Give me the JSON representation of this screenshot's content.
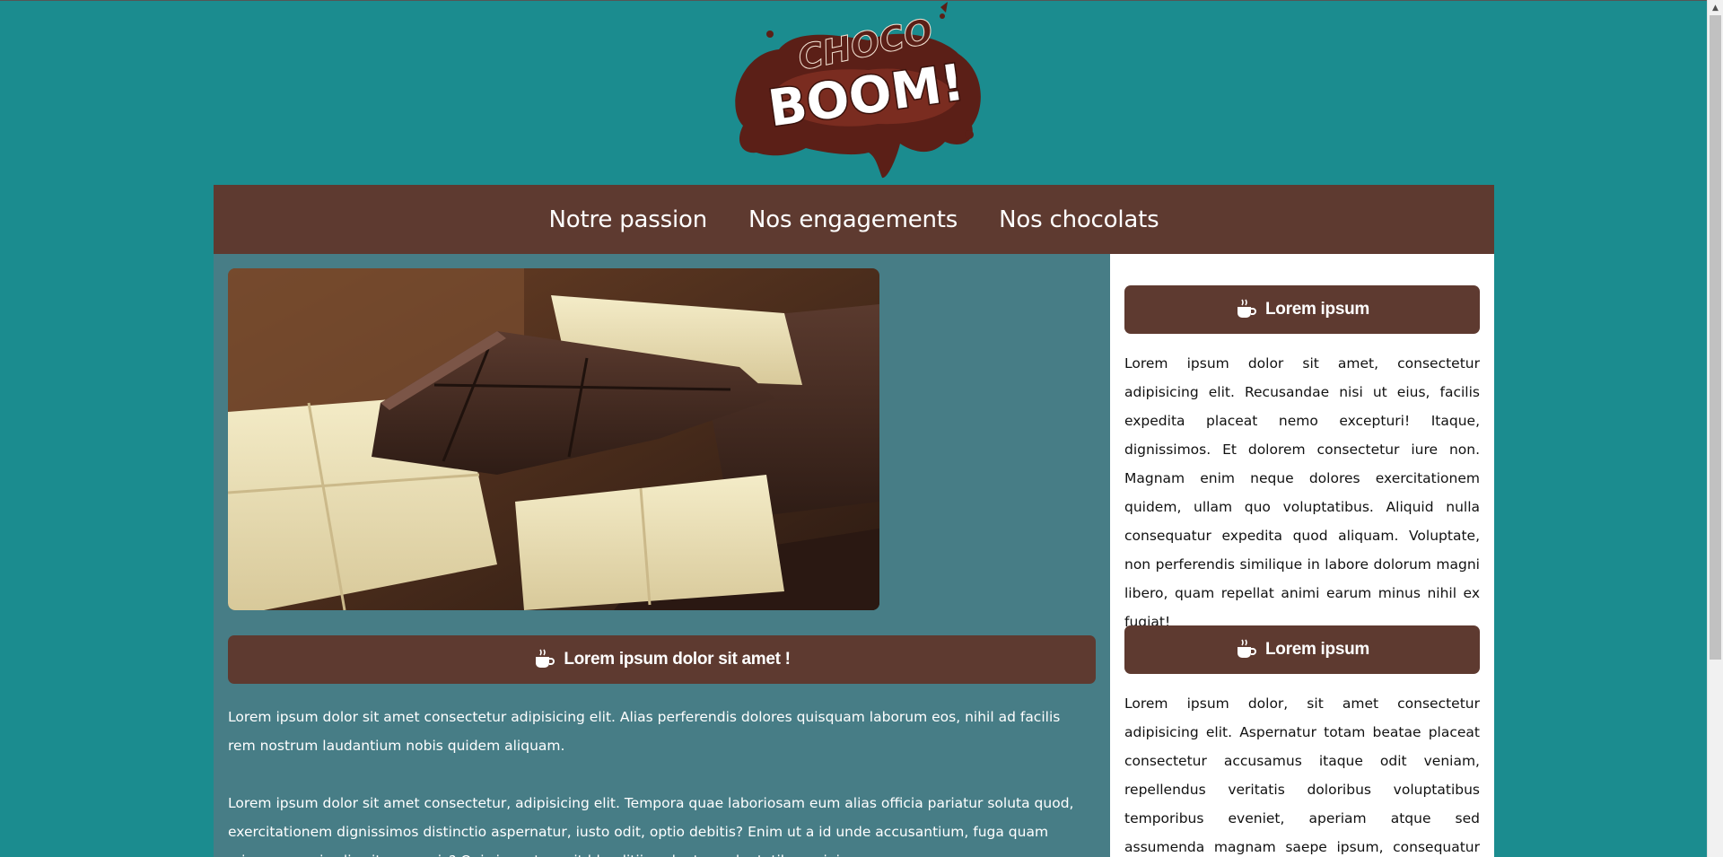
{
  "logo": {
    "alt": "Choco Boom logo",
    "text_top": "CHOCO",
    "text_main": "BOOM!"
  },
  "nav": {
    "items": [
      {
        "label": "Notre passion"
      },
      {
        "label": "Nos engagements"
      },
      {
        "label": "Nos chocolats"
      }
    ]
  },
  "main": {
    "hero_alt": "Chocolate pieces",
    "section_title": "Lorem ipsum dolor sit amet !",
    "paragraphs": [
      "Lorem ipsum dolor sit amet consectetur adipisicing elit. Alias perferendis dolores quisquam laborum eos, nihil ad facilis rem nostrum laudantium nobis quidem aliquam.",
      "Lorem ipsum dolor sit amet consectetur, adipisicing elit. Tempora quae laboriosam eum alias officia pariatur soluta quod, exercitationem dignissimos distinctio aspernatur, iusto odit, optio debitis? Enim ut a id unde accusantium, fuga quam minus corporis alias itaque quis? Quis inventore sit blanditiis voluptas voluptatibus minima."
    ]
  },
  "aside": {
    "blocks": [
      {
        "title": "Lorem ipsum",
        "text": "Lorem ipsum dolor sit amet, consectetur adipisicing elit. Recusandae nisi ut eius, facilis expedita placeat nemo excepturi! Itaque, dignissimos. Et dolorem consectetur iure non. Magnam enim neque dolores exercitationem quidem, ullam quo voluptatibus. Aliquid nulla consequatur expedita quod aliquam. Voluptate, non perferendis similique in labore dolorum magni libero, quam repellat animi earum minus nihil ex fugiat!"
      },
      {
        "title": "Lorem ipsum",
        "text": "Lorem ipsum dolor, sit amet consectetur adipisicing elit. Aspernatur totam beatae placeat consectetur accusamus itaque odit veniam, repellendus veritatis doloribus voluptatibus temporibus eveniet, aperiam atque sed assumenda magnam saepe ipsum, consequatur numquam. Illum, ut natus rerum autem"
      }
    ]
  },
  "icons": {
    "section_icon": "coffee-cup-icon"
  },
  "colors": {
    "page_bg": "#1b8c8f",
    "brown": "#5e3a30",
    "main_bg": "#477d86",
    "aside_bg": "#ffffff"
  }
}
